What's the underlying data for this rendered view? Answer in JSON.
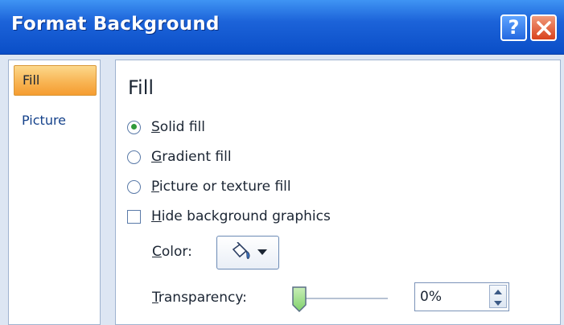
{
  "window": {
    "title": "Format Background"
  },
  "title_buttons": {
    "help": "?",
    "close": "close"
  },
  "nav": [
    {
      "label": "Fill",
      "selected": true
    },
    {
      "label": "Picture",
      "selected": false
    }
  ],
  "fill": {
    "section_title": "Fill",
    "options": [
      {
        "accel": "S",
        "rest": "olid fill",
        "selected": true
      },
      {
        "accel": "G",
        "rest": "radient fill",
        "selected": false
      },
      {
        "accel": "P",
        "rest": "icture or texture fill",
        "selected": false
      }
    ],
    "hide_graphics": {
      "accel": "H",
      "rest": "ide background graphics",
      "checked": false
    },
    "color": {
      "accel": "C",
      "rest": "olor:",
      "icon": "paint-bucket-icon"
    },
    "transparency": {
      "accel": "T",
      "rest": "ransparency:",
      "value": "0%",
      "level": 0
    }
  },
  "colors": {
    "accent": "#f8b554",
    "title_bar": "#1c63d9"
  }
}
